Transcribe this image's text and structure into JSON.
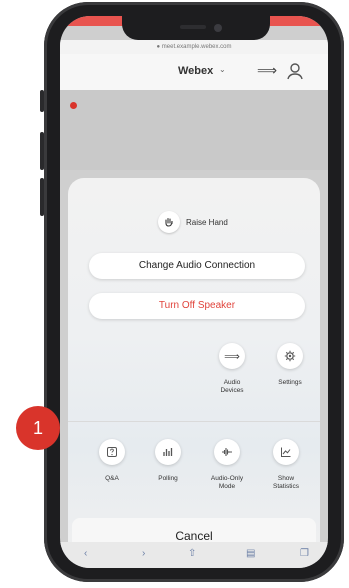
{
  "header": {
    "app_name": "Webex",
    "url_text": "● meet.example.webex.com"
  },
  "sheet": {
    "raise_hand": "Raise Hand",
    "change_audio": "Change Audio Connection",
    "turn_off_speaker": "Turn Off Speaker",
    "row1": [
      {
        "label_line1": "Audio",
        "label_line2": "Devices",
        "icon": "bluetooth-icon"
      },
      {
        "label_line1": "Settings",
        "label_line2": "",
        "icon": "gear-icon"
      }
    ],
    "row2": [
      {
        "label_line1": "Q&A",
        "label_line2": "",
        "icon": "question-icon"
      },
      {
        "label_line1": "Polling",
        "label_line2": "",
        "icon": "poll-icon"
      },
      {
        "label_line1": "Audio-Only",
        "label_line2": "Mode",
        "icon": "audio-wave-icon"
      },
      {
        "label_line1": "Show",
        "label_line2": "Statistics",
        "icon": "statistics-icon"
      }
    ],
    "cancel": "Cancel"
  },
  "callout": {
    "number": "1"
  },
  "colors": {
    "accent_red": "#d9342b",
    "speaker_red": "#e0443c"
  }
}
